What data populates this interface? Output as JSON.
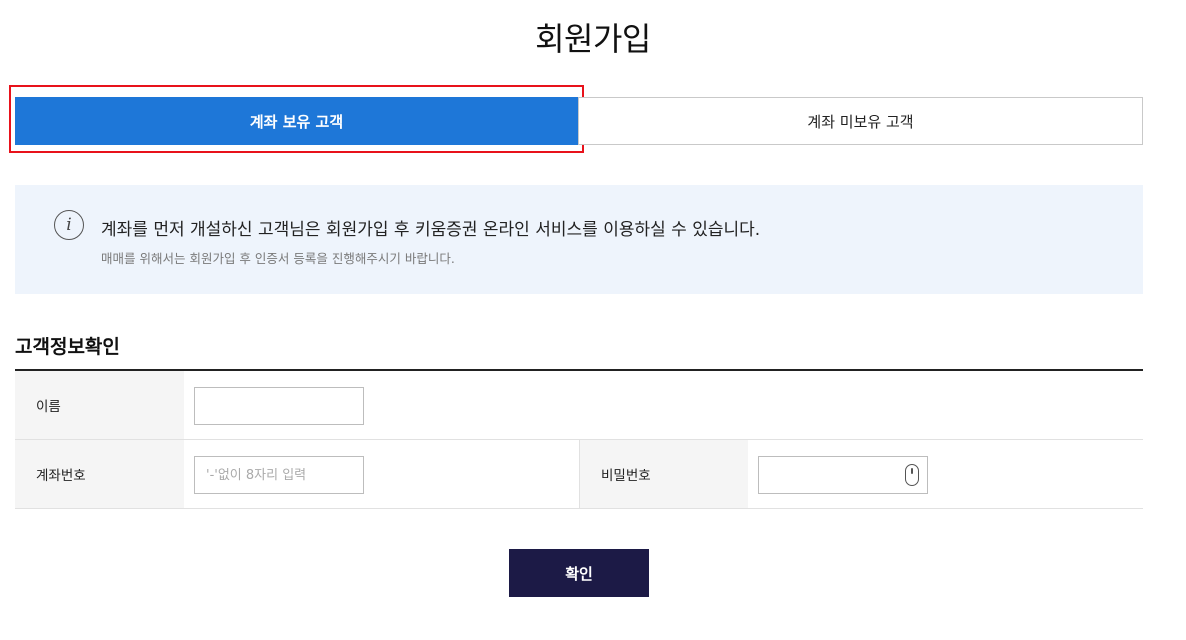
{
  "page": {
    "title": "회원가입"
  },
  "tabs": [
    {
      "label": "계좌 보유 고객",
      "active": true
    },
    {
      "label": "계좌 미보유 고객",
      "active": false
    }
  ],
  "notice": {
    "icon": "info-icon",
    "main_text": "계좌를 먼저 개설하신 고객님은 회원가입 후 키움증권 온라인 서비스를 이용하실 수 있습니다.",
    "sub_text": "매매를 위해서는 회원가입 후 인증서 등록을 진행해주시기 바랍니다."
  },
  "section": {
    "title": "고객정보확인"
  },
  "form": {
    "name_label": "이름",
    "name_value": "",
    "account_label": "계좌번호",
    "account_placeholder": "'-'없이 8자리 입력",
    "password_label": "비밀번호",
    "password_icon": "mouse-icon"
  },
  "actions": {
    "confirm_label": "확인"
  },
  "colors": {
    "active_tab": "#1e77d8",
    "highlight_border": "#e8121b",
    "notice_bg": "#eef4fc",
    "confirm_button": "#1c1a46"
  }
}
